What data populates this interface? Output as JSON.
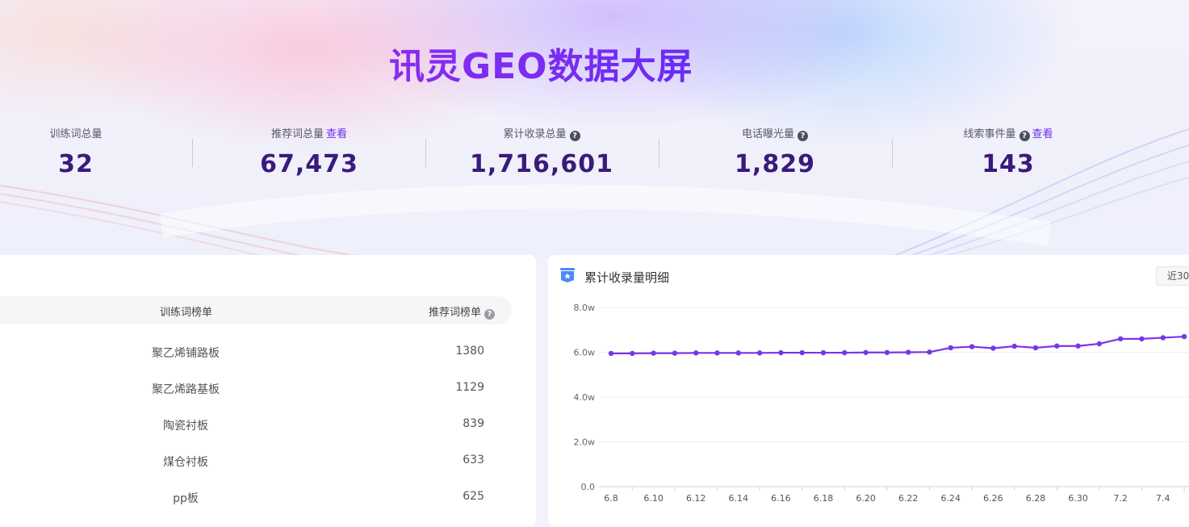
{
  "title": "讯灵GEO数据大屏",
  "stats": [
    {
      "label": "训练词总量",
      "value": "32",
      "link": "",
      "help": false
    },
    {
      "label": "推荐词总量",
      "value": "67,473",
      "link": "查看",
      "help": false
    },
    {
      "label": "累计收录总量",
      "value": "1,716,601",
      "link": "",
      "help": true
    },
    {
      "label": "电话曝光量",
      "value": "1,829",
      "link": "",
      "help": true
    },
    {
      "label": "线索事件量",
      "value": "143",
      "link": "查看",
      "help": true
    }
  ],
  "ranking": {
    "col1": "训练词榜单",
    "col2": "推荐词榜单",
    "rows": [
      {
        "keyword": "聚乙烯铺路板",
        "count": "1380"
      },
      {
        "keyword": "聚乙烯路基板",
        "count": "1129"
      },
      {
        "keyword": "陶瓷衬板",
        "count": "839"
      },
      {
        "keyword": "煤仓衬板",
        "count": "633"
      },
      {
        "keyword": "pp板",
        "count": "625"
      }
    ]
  },
  "chart_panel": {
    "title": "累计收录量明细",
    "range_button": "近30",
    "icon": "badge-star-icon"
  },
  "chart_data": {
    "type": "line",
    "title": "累计收录量明细",
    "x": [
      "6.8",
      "6.9",
      "6.10",
      "6.11",
      "6.12",
      "6.13",
      "6.14",
      "6.15",
      "6.16",
      "6.17",
      "6.18",
      "6.19",
      "6.20",
      "6.21",
      "6.22",
      "6.23",
      "6.24",
      "6.25",
      "6.26",
      "6.27",
      "6.28",
      "6.29",
      "6.30",
      "7.1",
      "7.2",
      "7.3",
      "7.4",
      "7.5"
    ],
    "x_tick_labels": [
      "6.8",
      "6.10",
      "6.12",
      "6.14",
      "6.16",
      "6.18",
      "6.20",
      "6.22",
      "6.24",
      "6.26",
      "6.28",
      "6.30",
      "7.2",
      "7.4"
    ],
    "series": [
      {
        "color": "#7b35e6",
        "values": [
          5.95,
          5.95,
          5.96,
          5.96,
          5.97,
          5.97,
          5.97,
          5.97,
          5.98,
          5.98,
          5.98,
          5.98,
          5.99,
          5.99,
          6.0,
          6.01,
          6.2,
          6.25,
          6.18,
          6.27,
          6.2,
          6.28,
          6.28,
          6.38,
          6.6,
          6.6,
          6.65,
          6.7
        ]
      }
    ],
    "y_ticks": [
      "8.0w",
      "6.0w",
      "4.0w",
      "2.0w",
      "0.0"
    ],
    "ylim": [
      0,
      8
    ],
    "y_unit": "w",
    "grid": true
  },
  "colors": {
    "accent": "#7b35e6",
    "title": "#7a2cf0",
    "value": "#3a1a7a"
  }
}
